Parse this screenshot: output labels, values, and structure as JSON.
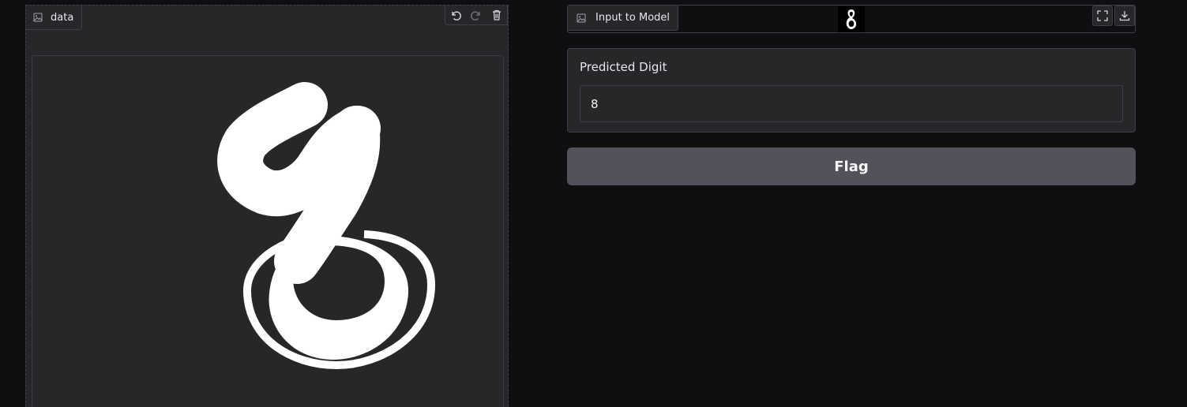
{
  "sketchpad": {
    "label": "data",
    "tools": {
      "undo_icon": "undo-icon",
      "redo_icon": "redo-icon",
      "clear_icon": "trash-icon"
    },
    "stroke_color": "#ffffff",
    "background_color": "#27272a"
  },
  "model_input": {
    "label": "Input to Model",
    "thumbnail_glyph": "8",
    "actions": {
      "fullscreen_icon": "fullscreen-icon",
      "download_icon": "download-icon"
    }
  },
  "prediction": {
    "label": "Predicted Digit",
    "value": "8"
  },
  "flag_button": {
    "label": "Flag"
  },
  "colors": {
    "page_background": "#0f0f11",
    "panel_background": "#27272a",
    "border": "#3f3f46",
    "button_background": "#52525b",
    "text": "#e5e7eb"
  }
}
